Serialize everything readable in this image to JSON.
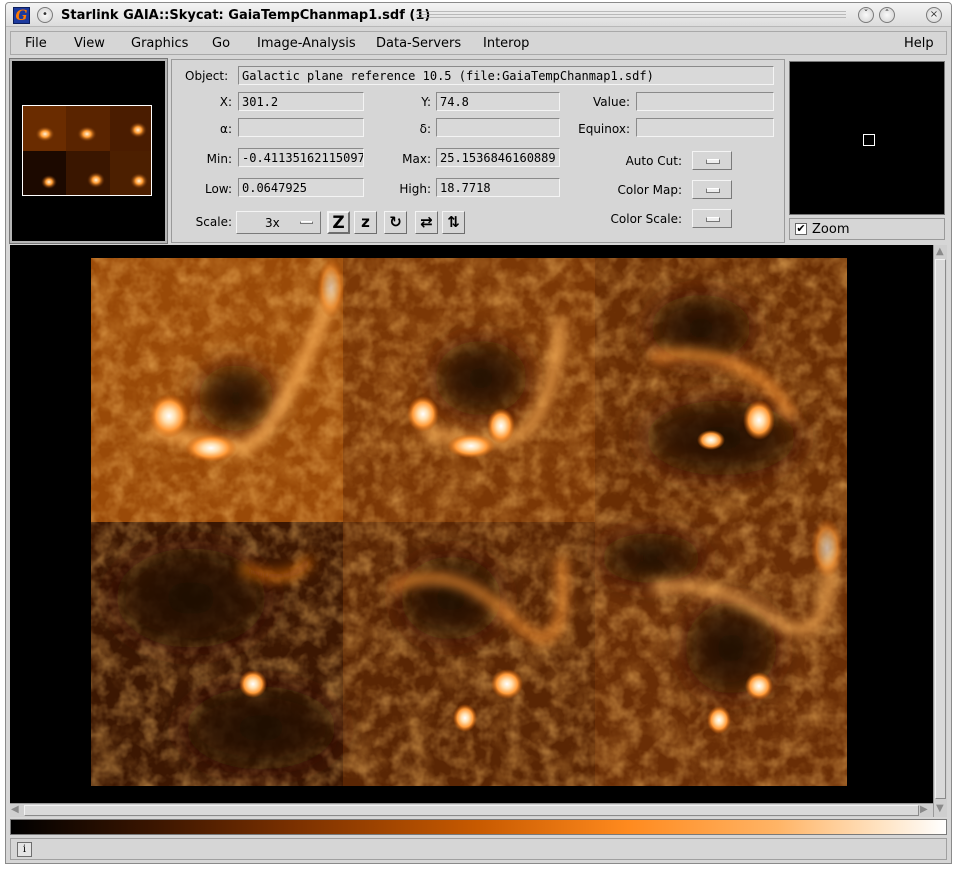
{
  "window": {
    "title": "Starlink GAIA::Skycat: GaiaTempChanmap1.sdf (1)",
    "minimize_glyph": "ˇ",
    "maximize_glyph": "ˆ",
    "close_glyph": "×",
    "menu_glyph": "•"
  },
  "menubar": {
    "items": [
      "File",
      "View",
      "Graphics",
      "Go",
      "Image-Analysis",
      "Data-Servers",
      "Interop"
    ],
    "help": "Help"
  },
  "info": {
    "object_label": "Object:",
    "object_value": "Galactic plane reference 10.5 (file:GaiaTempChanmap1.sdf)",
    "x_label": "X:",
    "x_value": "301.2",
    "y_label": "Y:",
    "y_value": "74.8",
    "value_label": "Value:",
    "value_value": "",
    "alpha_label": "α:",
    "alpha_value": "",
    "delta_label": "δ:",
    "delta_value": "",
    "equinox_label": "Equinox:",
    "equinox_value": "",
    "min_label": "Min:",
    "min_value": "-0.41135162115097",
    "max_label": "Max:",
    "max_value": "25.1536846160889",
    "low_label": "Low:",
    "low_value": "0.0647925",
    "high_label": "High:",
    "high_value": "18.7718",
    "autocut_label": "Auto Cut:",
    "colormap_label": "Color Map:",
    "colorscale_label": "Color Scale:",
    "scale_label": "Scale:",
    "scale_value": "3x"
  },
  "tools": {
    "zoom_in_glyph": "Z",
    "zoom_out_glyph": "z",
    "rotate_glyph": "↻",
    "flip_x_glyph": "⇄",
    "flip_y_glyph": "⇅"
  },
  "zoom": {
    "label": "Zoom",
    "checked_glyph": "✔"
  },
  "status": {
    "info_glyph": "i"
  },
  "colors": {
    "colormap_start": "#000000",
    "colormap_mid": "#c85a00",
    "colormap_end": "#ffffff"
  }
}
